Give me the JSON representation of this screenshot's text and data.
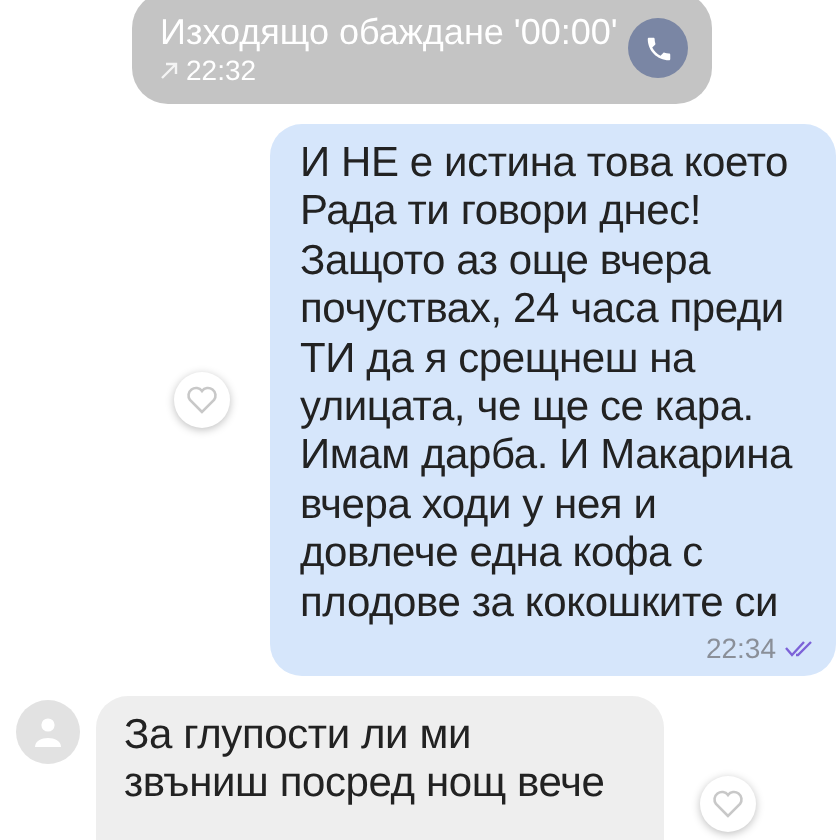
{
  "messages": [
    {
      "kind": "call",
      "text": "Изходящо обаждане '00:00'",
      "time": "22:32"
    },
    {
      "kind": "outgoing",
      "lines": [
        "И НЕ е истина това което",
        "Рада ти говори днес!",
        "Защото аз още вчера",
        "почуствах, 24 часа преди",
        "ТИ да я срещнеш на",
        "улицата, че ще се кара.",
        "Имам дарба. И Макарина",
        "вчера ходи у нея и",
        "довлече една кофа с",
        "плодове за кокошките си"
      ],
      "time": "22:34",
      "read": true,
      "liked": false
    },
    {
      "kind": "incoming",
      "lines": [
        "За глупости ли ми",
        "звъниш посред нощ вече"
      ],
      "liked": false
    }
  ]
}
